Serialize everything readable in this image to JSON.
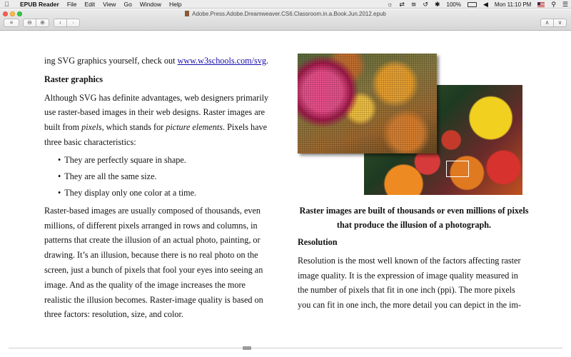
{
  "menubar": {
    "app_name": "EPUB Reader",
    "menus": [
      "File",
      "Edit",
      "View",
      "Go",
      "Window",
      "Help"
    ],
    "battery": "100%",
    "clock": "Mon 11:10 PM"
  },
  "window": {
    "title": "Adobe.Press.Adobe.Dreamweaver.CS6.Classroom.in.a.Book.Jun.2012.epub"
  },
  "toolbar": {
    "toc_icon": "≡",
    "zoom_out_icon": "⊖",
    "zoom_in_icon": "⊕",
    "prev_icon": "‹",
    "next_icon": "›",
    "up_icon": "∧",
    "down_icon": "∨"
  },
  "left": {
    "intro_prefix": "ing SVG graphics yourself, check out ",
    "intro_link": "www.w3schools.com/svg",
    "intro_suffix": ".",
    "heading": "Raster graphics",
    "p1_a": "Although SVG has definite advantages, web designers primarily use raster-based images in their web designs. Raster images are built from ",
    "p1_em1": "pixels",
    "p1_b": ", which stands for ",
    "p1_em2": "picture elements",
    "p1_c": ". Pixels have three basic characteristics:",
    "bullets": [
      "They are perfectly square in shape.",
      "They are all the same size.",
      "They display only one color at a time."
    ],
    "p2": "Raster-based images are usually composed of thousands, even millions, of different pixels arranged in rows and columns, in patterns that create the illusion of an actual photo, painting, or drawing. It’s an illusion, because there is no real photo on the screen, just a bunch of pixels that fool your eyes into seeing an image. And as the quality of the image increases the more realistic the illusion becomes. Raster-image quality is based on three factors: resolution, size, and color."
  },
  "right": {
    "caption": "Raster images are built of thousands or even millions of pixels that produce the illusion of a photograph.",
    "heading": "Resolution",
    "p1": "Resolution is the most well known of the factors affecting raster image quality. It is the expression of image quality measured in the number of pixels that fit in one inch (ppi). The more pixels you can fit in one inch, the more detail you can depict in the im-"
  }
}
